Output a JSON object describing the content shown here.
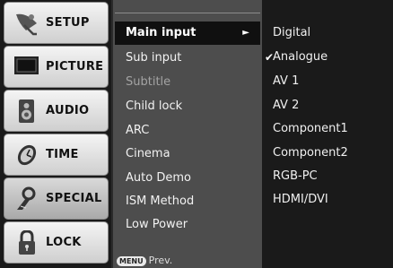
{
  "sidebar": {
    "items": [
      {
        "label": "SETUP",
        "icon": "satellite-icon"
      },
      {
        "label": "PICTURE",
        "icon": "tv-icon"
      },
      {
        "label": "AUDIO",
        "icon": "speaker-icon"
      },
      {
        "label": "TIME",
        "icon": "clock-icon"
      },
      {
        "label": "SPECIAL",
        "icon": "special-icon"
      },
      {
        "label": "LOCK",
        "icon": "lock-icon"
      }
    ],
    "active": "SPECIAL"
  },
  "menu": {
    "items": [
      {
        "label": "Main input",
        "selected": true
      },
      {
        "label": "Sub input"
      },
      {
        "label": "Subtitle",
        "disabled": true
      },
      {
        "label": "Child lock"
      },
      {
        "label": "ARC"
      },
      {
        "label": "Cinema"
      },
      {
        "label": "Auto Demo"
      },
      {
        "label": "ISM Method"
      },
      {
        "label": "Low Power"
      }
    ],
    "arrow": "►",
    "prev_key": "MENU",
    "prev_label": "Prev."
  },
  "options": {
    "items": [
      "Digital",
      "Analogue",
      "AV 1",
      "AV 2",
      "Component1",
      "Component2",
      "RGB-PC",
      "HDMI/DVI"
    ],
    "checked": "Analogue",
    "check_mark": "✔"
  }
}
